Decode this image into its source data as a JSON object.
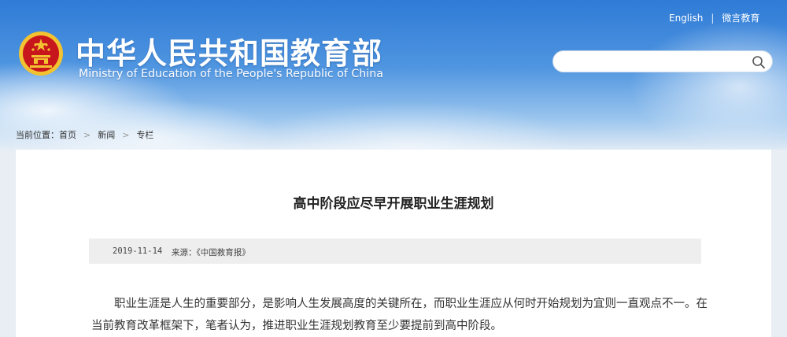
{
  "header": {
    "title_cn": "中华人民共和国教育部",
    "title_en": "Ministry of Education of the People's Republic of China",
    "links": {
      "english": "English",
      "separator": "|",
      "weibo": "微言教育"
    },
    "search": {
      "placeholder": ""
    }
  },
  "breadcrumb": {
    "prefix": "当前位置：",
    "items": [
      "首页",
      "新闻",
      "专栏"
    ],
    "arrow": ">"
  },
  "article": {
    "title": "高中阶段应尽早开展职业生涯规划",
    "date": "2019-11-14",
    "source": "来源：《中国教育报》",
    "body": "职业生涯是人生的重要部分，是影响人生发展高度的关键所在，而职业生涯应从何时开始规划为宜则一直观点不一。在当前教育改革框架下，笔者认为，推进职业生涯规划教育至少要提前到高中阶段。"
  },
  "colors": {
    "header_blue": "#2f7bd6",
    "emblem_red": "#c8161d",
    "emblem_gold": "#f2c230",
    "meta_bg": "#eeeeee"
  },
  "icons": {
    "emblem": "national-emblem-icon",
    "search": "search-icon"
  }
}
